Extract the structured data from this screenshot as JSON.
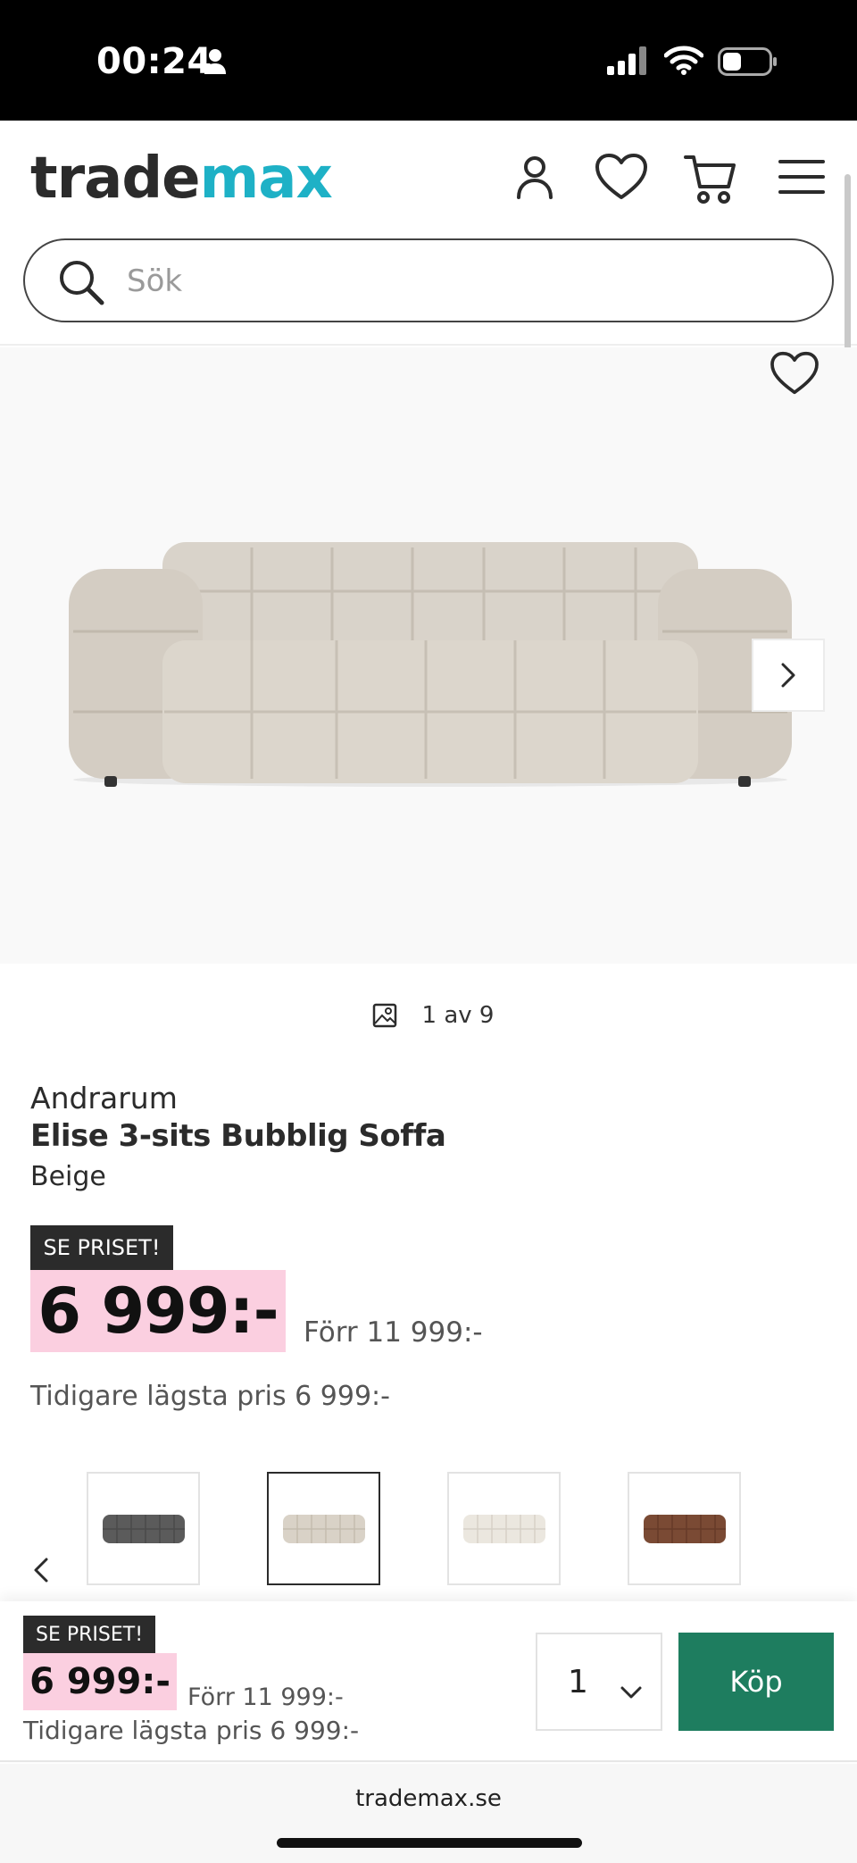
{
  "status": {
    "time": "00:24",
    "icons": [
      "person-icon",
      "signal-icon",
      "wifi-icon",
      "battery-icon"
    ]
  },
  "header": {
    "logo_part1": "trade",
    "logo_part2": "max",
    "icons": [
      "account-icon",
      "heart-icon",
      "cart-icon",
      "menu-icon"
    ],
    "search_placeholder": "Sök",
    "colors": {
      "logo_dark": "#2b2b2b",
      "logo_accent": "#1eb1c6"
    }
  },
  "gallery": {
    "counter": "1 av 9",
    "icons": [
      "favorite-icon",
      "next-arrow-icon",
      "image-icon"
    ]
  },
  "product": {
    "brand": "Andrarum",
    "name": "Elise 3-sits Bubblig Soffa",
    "color": "Beige",
    "badge": "SE PRISET!",
    "price": "6 999:-",
    "previous_price": "Förr 11 999:-",
    "lowest_price": "Tidigare lägsta pris 6 999:-",
    "colors": {
      "price_bg": "#fbcfe0",
      "badge_bg": "#2b2b2b"
    }
  },
  "variants": [
    {
      "color": "#5b5b5b",
      "label": "dark-grey"
    },
    {
      "color": "#d9d2c7",
      "label": "beige"
    },
    {
      "color": "#ebe7df",
      "label": "cream"
    },
    {
      "color": "#7a4a34",
      "label": "brown"
    }
  ],
  "buybar": {
    "badge": "SE PRISET!",
    "price": "6 999:-",
    "previous_price": "Förr 11 999:-",
    "lowest_price": "Tidigare lägsta pris 6 999:-",
    "quantity": "1",
    "buy_label": "Köp",
    "buy_color": "#1e7d5f"
  },
  "browser": {
    "url": "trademax.se"
  }
}
